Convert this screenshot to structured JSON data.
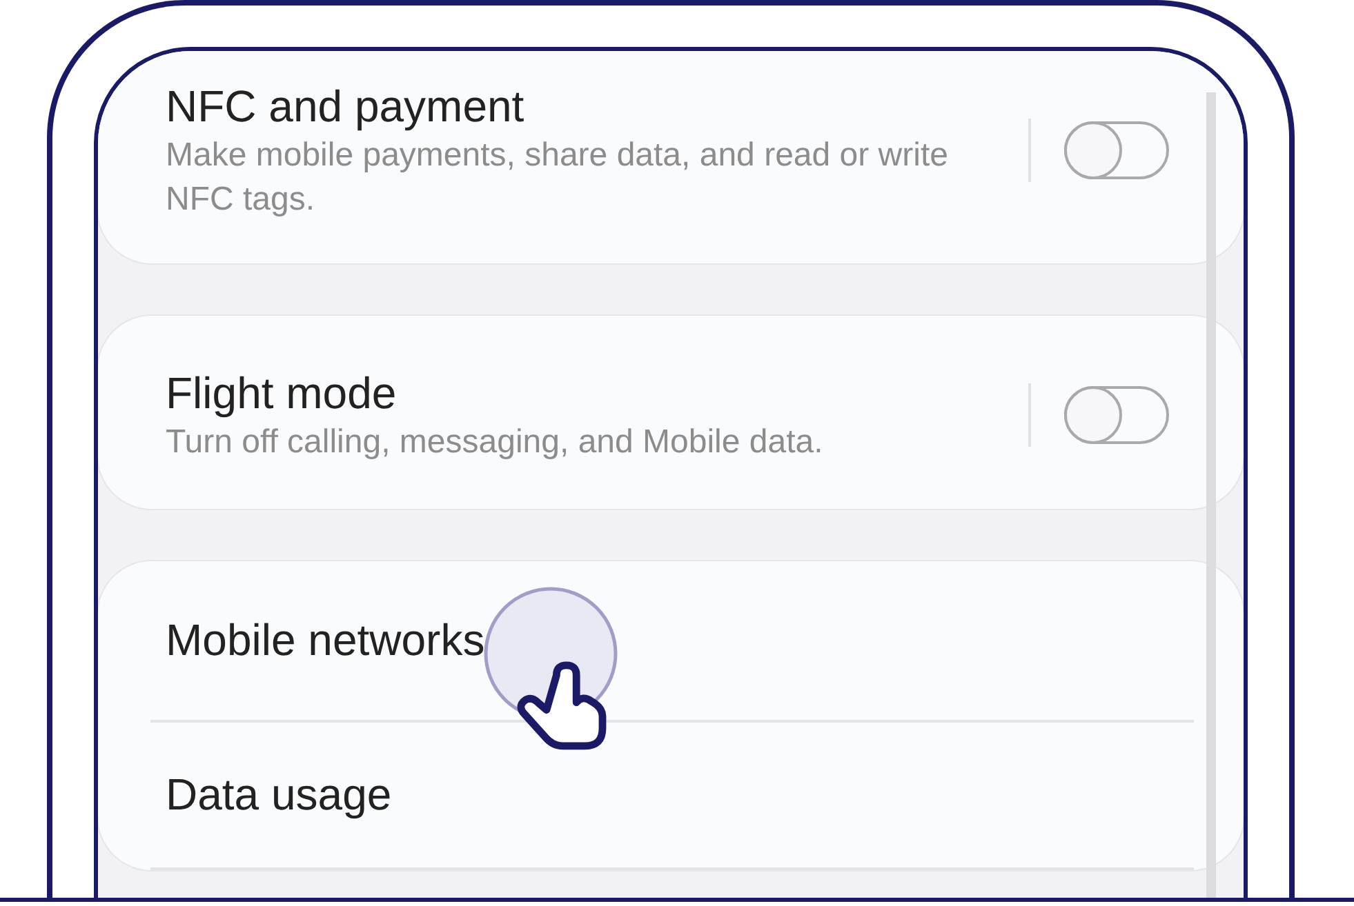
{
  "cards": [
    {
      "items": [
        {
          "kind": "toggle",
          "title": "NFC and payment",
          "subtitle": "Make mobile payments, share data, and read or write NFC tags.",
          "on": false
        }
      ]
    },
    {
      "items": [
        {
          "kind": "toggle",
          "title": "Flight mode",
          "subtitle": "Turn off calling, messaging, and Mobile data.",
          "on": false
        }
      ]
    },
    {
      "items": [
        {
          "kind": "link",
          "title": "Mobile networks"
        },
        {
          "kind": "link",
          "title": "Data usage"
        }
      ]
    }
  ]
}
